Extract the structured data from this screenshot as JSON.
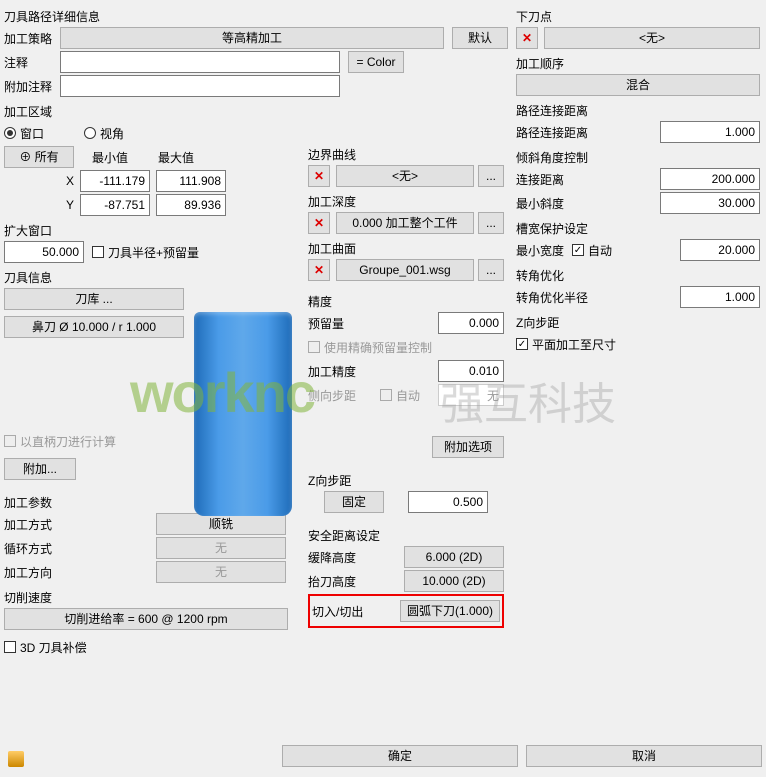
{
  "title": "刀具路径详细信息",
  "strategy": {
    "label": "加工策略",
    "value": "等高精加工",
    "default_btn": "默认"
  },
  "comment": {
    "label": "注释",
    "value": "",
    "color_btn": "= Color"
  },
  "extra_comment": {
    "label": "附加注释",
    "value": ""
  },
  "zone": {
    "title": "加工区域",
    "window": "窗口",
    "view": "视角",
    "all_btn": "所有",
    "min": "最小值",
    "max": "最大值",
    "x": "X",
    "x_min": "-111.179",
    "x_max": "111.908",
    "y": "Y",
    "y_min": "-87.751",
    "y_max": "89.936"
  },
  "expand": {
    "title": "扩大窗口",
    "value": "50.000",
    "cb": "刀具半径+预留量"
  },
  "tool": {
    "title": "刀具信息",
    "lib_btn": "刀库 ...",
    "desc": "鼻刀 Ø 10.000 / r 1.000",
    "calc_cb": "以直柄刀进行计算",
    "attach_btn": "附加..."
  },
  "params": {
    "title": "加工参数",
    "method": {
      "label": "加工方式",
      "value": "顺铣"
    },
    "loop": {
      "label": "循环方式",
      "value": "无"
    },
    "dir": {
      "label": "加工方向",
      "value": "无"
    },
    "speed": {
      "title": "切削速度",
      "value": "切削进给率 = 600 @ 1200 rpm"
    },
    "comp_cb": "3D 刀具补偿"
  },
  "mid": {
    "boundary": {
      "title": "边界曲线",
      "value": "<无>"
    },
    "depth": {
      "title": "加工深度",
      "value": "0.000 加工整个工件"
    },
    "surface": {
      "title": "加工曲面",
      "value": "Groupe_001.wsg"
    },
    "precision": {
      "title": "精度",
      "stock": {
        "label": "预留量",
        "value": "0.000"
      },
      "stock_cb": "使用精确预留量控制",
      "tol": {
        "label": "加工精度",
        "value": "0.010"
      },
      "step": {
        "label": "侧向步距",
        "auto": "自动",
        "value": "无"
      },
      "opt_btn": "附加选项"
    },
    "zstep": {
      "title": "Z向步距",
      "mode": "固定",
      "value": "0.500"
    },
    "safe": {
      "title": "安全距离设定",
      "slow": {
        "label": "缓降高度",
        "value": "6.000 (2D)"
      },
      "lift": {
        "label": "抬刀高度",
        "value": "10.000 (2D)"
      },
      "cut": {
        "label": "切入/切出",
        "value": "圆弧下刀(1.000)"
      }
    }
  },
  "right": {
    "plunge": {
      "title": "下刀点",
      "value": "<无>"
    },
    "order": {
      "title": "加工顺序",
      "value": "混合"
    },
    "link": {
      "title": "路径连接距离",
      "label": "路径连接距离",
      "value": "1.000"
    },
    "incline": {
      "title": "倾斜角度控制",
      "dist": {
        "label": "连接距离",
        "value": "200.000"
      },
      "slope": {
        "label": "最小斜度",
        "value": "30.000"
      }
    },
    "slot": {
      "title": "槽宽保护设定",
      "label": "最小宽度",
      "auto": "自动",
      "value": "20.000"
    },
    "corner": {
      "title": "转角优化",
      "label": "转角优化半径",
      "value": "1.000"
    },
    "zstep": {
      "title": "Z向步距",
      "cb": "平面加工至尺寸"
    }
  },
  "bottom": {
    "ok": "确定",
    "cancel": "取消"
  },
  "wm1": "worknc",
  "wm2": "强互科技"
}
